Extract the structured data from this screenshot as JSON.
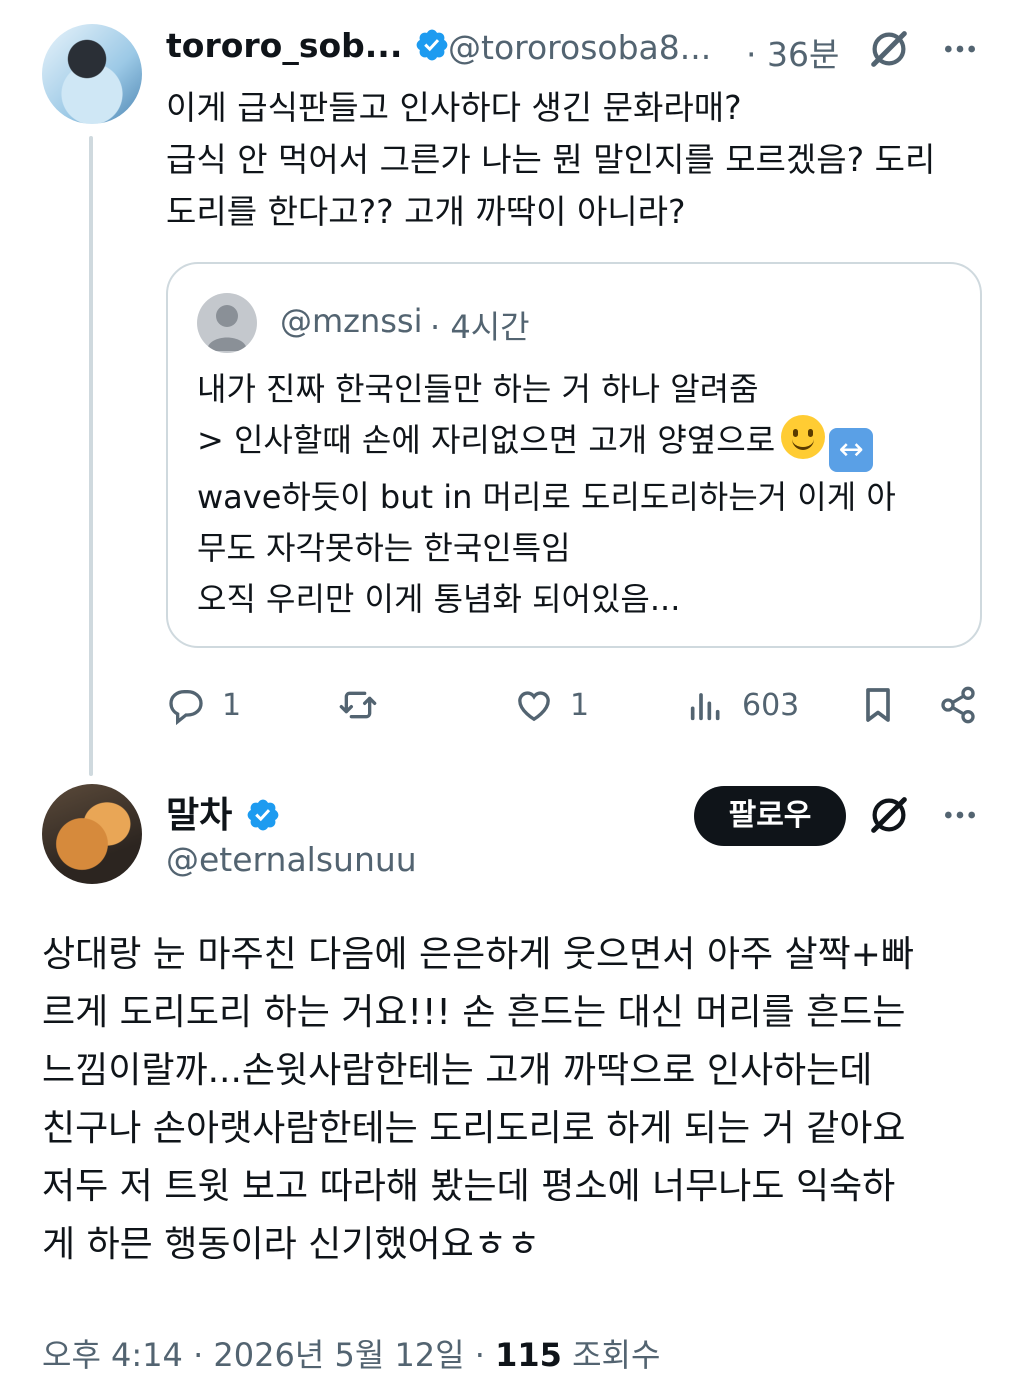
{
  "tweet1": {
    "display_name": "tororo_sob...",
    "handle": "@tororosoba8...",
    "time": "· 36분",
    "body": "이게 급식판들고 인사하다 생긴 문화라매?\n급식 안 먹어서 그른가 나는 뭔 말인지를 모르겠음? 도리\n도리를 한다고?? 고개 까딱이 아니라?",
    "quote": {
      "handle": "@mznssi",
      "time": "· 4시간",
      "lines": [
        "내가 진짜 한국인들만 하는 거 하나 알려줌",
        "> 인사할때 손에 자리없으면 고개 양옆으로",
        "wave하듯이 but in 머리로 도리도리하는거 이게 아",
        "무도 자각못하는 한국인특임",
        "오직 우리만 이게 통념화 되어있음..."
      ]
    },
    "actions": {
      "reply_count": "1",
      "like_count": "1",
      "views_count": "603"
    }
  },
  "tweet2": {
    "display_name": "말차",
    "handle": "@eternalsunuu",
    "follow_label": "팔로우",
    "lines": [
      "상대랑 눈 마주친 다음에 은은하게 웃으면서 아주 살짝+빠",
      "르게 도리도리 하는 거요!!! 손 흔드는 대신 머리를 흔드는",
      "느낌이랄까...손윗사람한테는 고개 까딱으로 인사하는데",
      "친구나 손아랫사람한테는 도리도리로 하게 되는 거 같아요",
      "저두 저 트윗 보고 따라해 봤는데 평소에 너무나도 익숙하",
      "게 하믄 행동이라 신기했어요ㅎㅎ"
    ],
    "meta": {
      "time_date": "오후 4:14 · 2026년 5월 12일 · ",
      "views": "115",
      "views_label": " 조회수"
    }
  },
  "colors": {
    "text": "#0f1419",
    "secondary": "#536471",
    "verified": "#1d9bf0",
    "border": "#cfd9de"
  },
  "icons": [
    "verified-badge-icon",
    "grok-icon",
    "more-icon",
    "reply-icon",
    "retweet-icon",
    "like-icon",
    "views-icon",
    "bookmark-icon",
    "share-icon"
  ]
}
